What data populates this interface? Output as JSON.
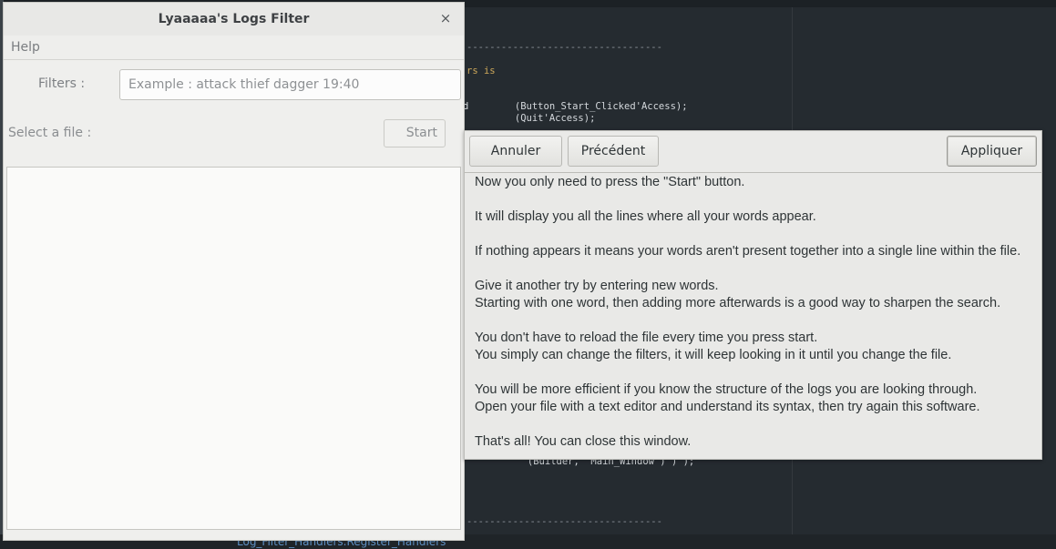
{
  "main_window": {
    "title": "Lyaaaaa's Logs Filter",
    "close_glyph": "×",
    "menu": {
      "help_label": "Help"
    },
    "filters_label": "Filters :",
    "filters_placeholder": "Example : attack thief dagger 19:40",
    "file_label": "Select a file :",
    "start_label": "Start"
  },
  "help_dialog": {
    "buttons": {
      "cancel": "Annuler",
      "previous": "Précédent",
      "apply": "Appliquer"
    },
    "lines": [
      "Now you only need to press the \"Start\" button.",
      "It will display you all the lines where all your words appear.",
      "If nothing appears it means your words aren't present together into a single line within the file.",
      "Give it another try by entering new words.",
      "Starting with one word, then adding more afterwards is a good way to sharpen the search.",
      "You don't have to reload the file every time you press start.",
      "You simply can change the filters, it will keep looking in it until you change the file.",
      "You will be more efficient if you know the structure of the logs you are looking through.",
      "Open your file with a text editor and understand its syntax, then try again this software.",
      "That's all! You can close this window."
    ]
  },
  "editor_background": {
    "code_lines": [
      "----------------------------------",
      "rs is",
      "d        (Button_Start_Clicked'Access);",
      "         (Quit'Access);",
      "         (Builder, \"Main_Window\") ) );",
      "----------------------------------"
    ],
    "status_text": "Log_Filter_Handlers.Register_Handlers"
  },
  "colors": {
    "editor_bg": "#252b30",
    "window_bg": "#efefed",
    "dialog_bg": "#e9e9e7",
    "text": "#2e3436",
    "muted_text": "#8a8d90",
    "status_link": "#5d8fc3"
  }
}
